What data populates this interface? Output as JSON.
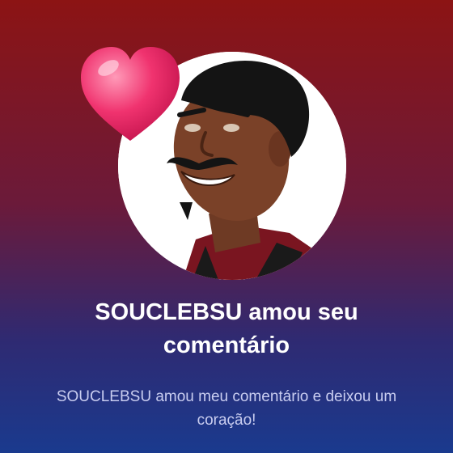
{
  "notification": {
    "title": "SOUCLEBSU amou seu comentário",
    "subtitle": "SOUCLEBSU amou meu comentário e deixou um coração!"
  },
  "icons": {
    "reaction": "heart-icon",
    "avatar": "user-avatar"
  },
  "colors": {
    "gradient_top": "#8c1414",
    "gradient_bottom": "#1a3a8e",
    "heart": "#f0336f",
    "title_text": "#ffffff",
    "subtitle_text": "#c9cdf0"
  }
}
